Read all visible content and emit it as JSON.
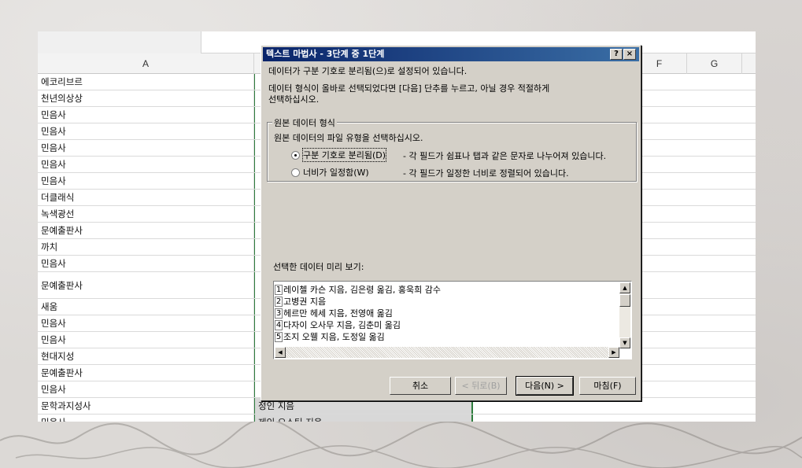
{
  "spreadsheet": {
    "columns": [
      "A",
      "F",
      "G"
    ],
    "rows": [
      {
        "a": "에코리브르",
        "b": ""
      },
      {
        "a": "천년의상상",
        "b": ""
      },
      {
        "a": "민음사",
        "b": ""
      },
      {
        "a": "민음사",
        "b": ""
      },
      {
        "a": "민음사",
        "b": ""
      },
      {
        "a": "민음사",
        "b": ""
      },
      {
        "a": "민음사",
        "b": ""
      },
      {
        "a": "더클래식",
        "b": ""
      },
      {
        "a": "녹색광선",
        "b": ""
      },
      {
        "a": "문예출판사",
        "b": ""
      },
      {
        "a": "까치",
        "b": ""
      },
      {
        "a": "민음사",
        "b": ""
      },
      {
        "a": "문예출판사",
        "b": ""
      },
      {
        "a": "새움",
        "b": ""
      },
      {
        "a": "민음사",
        "b": ""
      },
      {
        "a": "민음사",
        "b": ""
      },
      {
        "a": "현대지성",
        "b": ""
      },
      {
        "a": "문예출판사",
        "b": ""
      },
      {
        "a": "민음사",
        "b": ""
      },
      {
        "a": "문학과지성사",
        "b": "정인 지음"
      },
      {
        "a": "민음사",
        "b": "제인 오스틴 지음"
      }
    ]
  },
  "dialog": {
    "title": "텍스트 마법사 - 3단계 중 1단계",
    "help_label": "?",
    "close_label": "×",
    "intro_line": "데이터가 구분 기호로 분리됨(으)로 설정되어 있습니다.",
    "instruction_line1": "데이터 형식이 올바로 선택되었다면 [다음] 단추를 누르고, 아닐 경우 적절하게",
    "instruction_line2": "선택하십시오.",
    "group_title": "원본 데이터 형식",
    "group_prompt": "원본 데이터의 파일 유형을 선택하십시오.",
    "options": [
      {
        "label": "구분 기호로 분리됨(D)",
        "description": "- 각 필드가 쉼표나 탭과 같은 문자로 나누어져 있습니다.",
        "selected": true
      },
      {
        "label": "너비가 일정함(W)",
        "description": "- 각 필드가 일정한 너비로 정렬되어 있습니다.",
        "selected": false
      }
    ],
    "preview_label": "선택한 데이터 미리 보기:",
    "preview_lines": [
      {
        "num": "1",
        "text": "레이첼 카슨 지음, 김은령 옮김, 홍욱희 감수"
      },
      {
        "num": "2",
        "text": "고병권 지음"
      },
      {
        "num": "3",
        "text": "헤르만 헤세 지음, 전영애 옮김"
      },
      {
        "num": "4",
        "text": "다자이 오사무 지음, 김춘미 옮김"
      },
      {
        "num": "5",
        "text": "조지 오웰 지음, 도정일 옮김"
      }
    ],
    "buttons": {
      "cancel": "취소",
      "back": "< 뒤로(B)",
      "next": "다음(N) >",
      "finish": "마침(F)"
    }
  }
}
